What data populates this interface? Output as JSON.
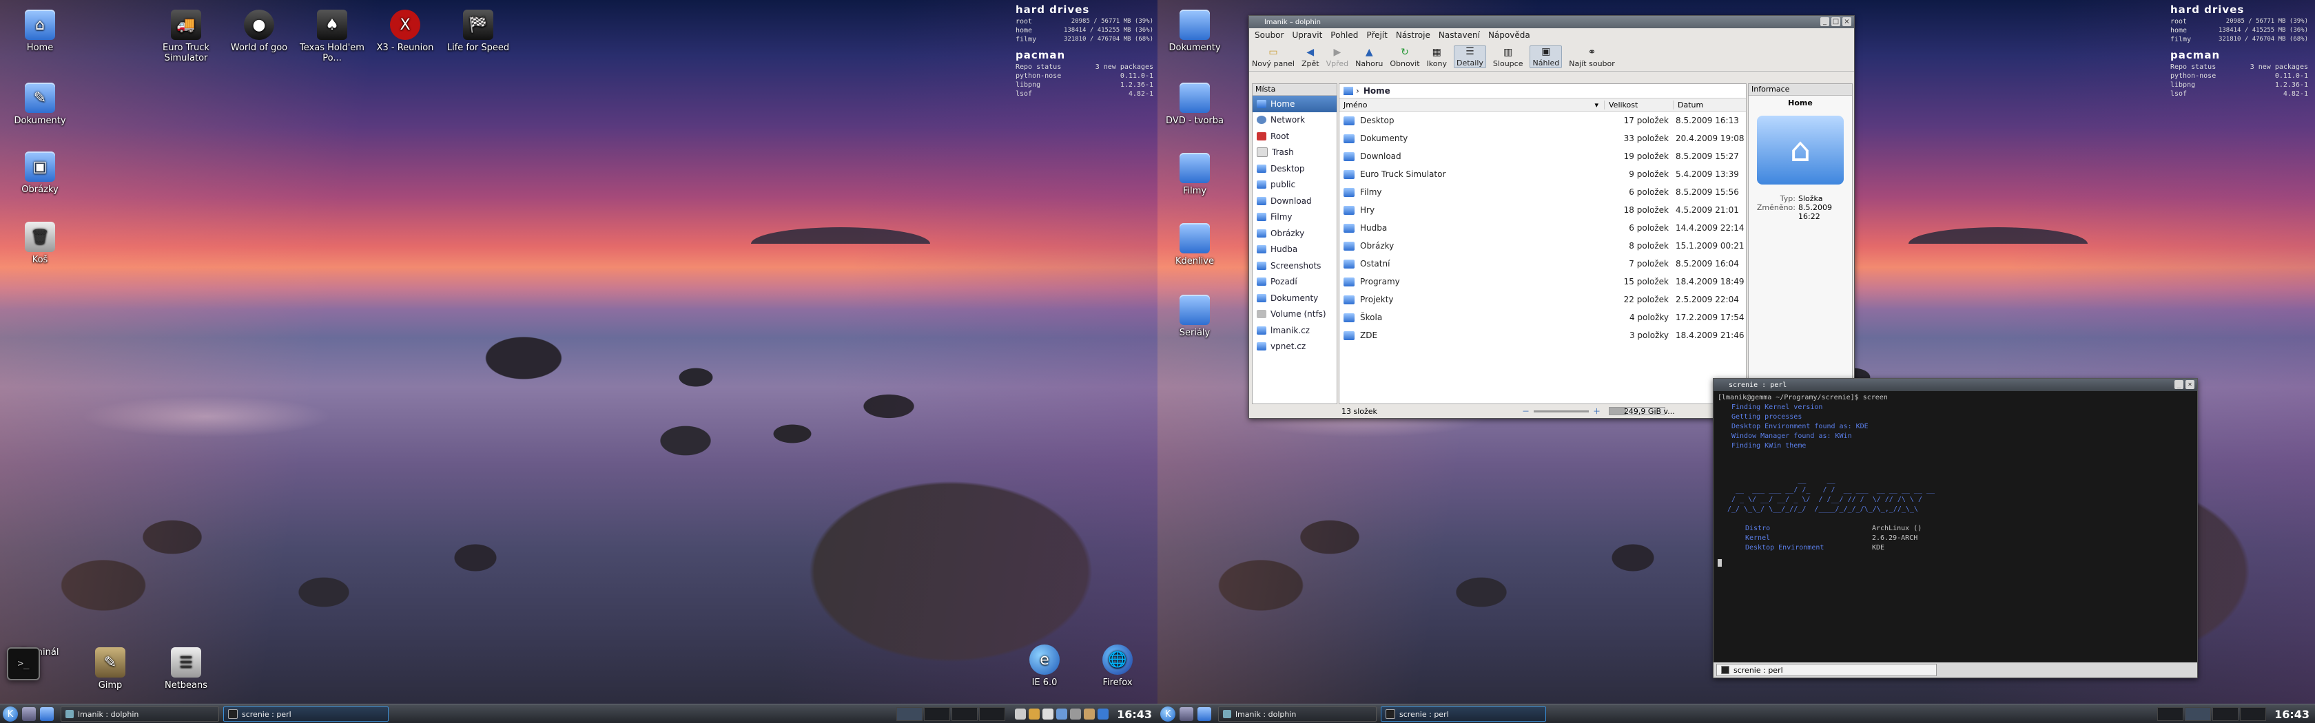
{
  "left_screen": {
    "desktop_icons": [
      {
        "label": "Home",
        "icon": "folder-home-icon"
      },
      {
        "label": "Euro Truck Simulator",
        "icon": "truck-game-icon"
      },
      {
        "label": "World of goo",
        "icon": "goo-ball-icon"
      },
      {
        "label": "Texas Hold'em Po...",
        "icon": "poker-cards-icon"
      },
      {
        "label": "X3 - Reunion",
        "icon": "x3-logo-icon"
      },
      {
        "label": "Life for Speed",
        "icon": "racing-game-icon"
      },
      {
        "label": "Dokumenty",
        "icon": "folder-documents-icon"
      },
      {
        "label": "Obrázky",
        "icon": "folder-pictures-icon"
      },
      {
        "label": "Koš",
        "icon": "trash-icon"
      },
      {
        "label": "Terminál",
        "icon": "terminal-icon"
      },
      {
        "label": "Gimp",
        "icon": "gimp-icon"
      },
      {
        "label": "Netbeans",
        "icon": "netbeans-icon"
      },
      {
        "label": "IE 6.0",
        "icon": "ie-icon"
      },
      {
        "label": "Firefox",
        "icon": "firefox-icon"
      }
    ],
    "taskbar": [
      {
        "label": "lmanik : dolphin",
        "active": false
      },
      {
        "label": "screnie : perl",
        "active": true
      }
    ]
  },
  "right_screen": {
    "desktop_icons": [
      {
        "label": "Dokumenty",
        "icon": "folder-icon"
      },
      {
        "label": "DVD - tvorba",
        "icon": "folder-icon"
      },
      {
        "label": "Filmy",
        "icon": "folder-icon"
      },
      {
        "label": "Kdenlive",
        "icon": "folder-icon"
      },
      {
        "label": "Seriály",
        "icon": "folder-icon"
      }
    ],
    "taskbar": [
      {
        "label": "lmanik : dolphin",
        "active": false
      },
      {
        "label": "screnie : perl",
        "active": true
      }
    ]
  },
  "conky": {
    "hard_drives_title": "hard drives",
    "drives": [
      {
        "name": "root",
        "value": "20985 / 56771 MB",
        "pct": "(39%)"
      },
      {
        "name": "home",
        "value": "138414 / 415255 MB",
        "pct": "(36%)"
      },
      {
        "name": "filmy",
        "value": "321810 / 476704 MB",
        "pct": "(68%)"
      }
    ],
    "pacman_title": "pacman",
    "repo_status_label": "Repo status",
    "repo_status_value": "3 new packages",
    "packages": [
      {
        "name": "python-nose",
        "version": "0.11.0-1"
      },
      {
        "name": "libpng",
        "version": "1.2.36-1"
      },
      {
        "name": "lsof",
        "version": "4.82-1"
      }
    ]
  },
  "clock": "16:43",
  "dolphin": {
    "title": "lmanik – dolphin",
    "menu": [
      "Soubor",
      "Upravit",
      "Pohled",
      "Přejít",
      "Nástroje",
      "Nastavení",
      "Nápověda"
    ],
    "toolbar": [
      {
        "label": "Nový panel",
        "icon": "new-tab-icon",
        "disabled": false,
        "active": false
      },
      {
        "label": "Zpět",
        "icon": "back-arrow-icon",
        "disabled": false,
        "active": false
      },
      {
        "label": "Vpřed",
        "icon": "forward-arrow-icon",
        "disabled": true,
        "active": false
      },
      {
        "label": "Nahoru",
        "icon": "up-arrow-icon",
        "disabled": false,
        "active": false
      },
      {
        "label": "Obnovit",
        "icon": "reload-icon",
        "disabled": false,
        "active": false
      },
      {
        "label": "Ikony",
        "icon": "icons-view-icon",
        "disabled": false,
        "active": false
      },
      {
        "label": "Detaily",
        "icon": "details-view-icon",
        "disabled": false,
        "active": true
      },
      {
        "label": "Sloupce",
        "icon": "columns-view-icon",
        "disabled": false,
        "active": false
      },
      {
        "label": "Náhled",
        "icon": "preview-icon",
        "disabled": false,
        "active": true
      },
      {
        "label": "Najít soubor",
        "icon": "binoculars-icon",
        "disabled": false,
        "active": false
      }
    ],
    "places_title": "Místa",
    "places": [
      "Home",
      "Network",
      "Root",
      "Trash",
      "Desktop",
      "public",
      "Download",
      "Filmy",
      "Obrázky",
      "Hudba",
      "Screenshots",
      "Pozadí",
      "Dokumenty",
      "Volume (ntfs)",
      "lmanik.cz",
      "vpnet.cz"
    ],
    "breadcrumb": "Home",
    "columns": {
      "name": "Jméno",
      "size": "Velikost",
      "date": "Datum"
    },
    "files": [
      {
        "name": "Desktop",
        "size": "17 položek",
        "date": "8.5.2009 16:13"
      },
      {
        "name": "Dokumenty",
        "size": "33 položek",
        "date": "20.4.2009 19:08"
      },
      {
        "name": "Download",
        "size": "19 položek",
        "date": "8.5.2009 15:27"
      },
      {
        "name": "Euro Truck Simulator",
        "size": "9 položek",
        "date": "5.4.2009 13:39"
      },
      {
        "name": "Filmy",
        "size": "6 položek",
        "date": "8.5.2009 15:56"
      },
      {
        "name": "Hry",
        "size": "18 položek",
        "date": "4.5.2009 21:01"
      },
      {
        "name": "Hudba",
        "size": "6 položek",
        "date": "14.4.2009 22:14"
      },
      {
        "name": "Obrázky",
        "size": "8 položek",
        "date": "15.1.2009 00:21"
      },
      {
        "name": "Ostatní",
        "size": "7 položek",
        "date": "8.5.2009 16:04"
      },
      {
        "name": "Programy",
        "size": "15 položek",
        "date": "18.4.2009 18:49"
      },
      {
        "name": "Projekty",
        "size": "22 položek",
        "date": "2.5.2009 22:04"
      },
      {
        "name": "Škola",
        "size": "4 položky",
        "date": "17.2.2009 17:54"
      },
      {
        "name": "ZDE",
        "size": "3 položky",
        "date": "18.4.2009 21:46"
      }
    ],
    "info_title": "Informace",
    "info_name": "Home",
    "info_type_label": "Typ:",
    "info_type_value": "Složka",
    "info_modified_label": "Změněno:",
    "info_modified_value": "8.5.2009 16:22",
    "status_count": "13 složek",
    "status_free": "249,9 GiB v..."
  },
  "terminal": {
    "title": "screnie : perl",
    "prompt_line": "[lmanik@gemma ~/Programy/screnie]$ screen",
    "steps": [
      "Finding Kernel version",
      "Getting processes",
      "Desktop Environment found as: KDE",
      "Window Manager found as: KWin",
      "Finding KWin theme"
    ],
    "ascii_art": [
      "                 __     __",
      "  __  ___ ___ __/ /_   / /  __ ___  __ __ __ __ __",
      " / _ \\/ __/ __/ _ \\/  / /__/ // /  \\/ // /\\ \\ /",
      "/_/ \\_\\_/ \\__/_//_/  /____/_/_/_/\\_/\\_,_//_\\_\\"
    ],
    "info": [
      {
        "key": "Distro",
        "value": "ArchLinux ()"
      },
      {
        "key": "Kernel",
        "value": "2.6.29-ARCH"
      },
      {
        "key": "Desktop Environment",
        "value": "KDE"
      }
    ],
    "tab_label": "screnie : perl"
  }
}
